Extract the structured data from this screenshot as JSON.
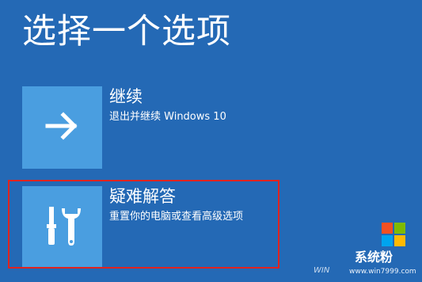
{
  "page": {
    "title": "选择一个选项"
  },
  "options": [
    {
      "title": "继续",
      "description": "退出并继续 Windows 10",
      "icon": "arrow-right-icon"
    },
    {
      "title": "疑难解答",
      "description": "重置你的电脑或查看高级选项",
      "icon": "tools-icon"
    }
  ],
  "watermark": {
    "brand": "系统粉",
    "url": "www.win7999.com",
    "url_prefix": "WIN",
    "logo_icon": "windows-logo-icon",
    "logo_colors": [
      "#f25022",
      "#7fba00",
      "#00a4ef",
      "#ffb900"
    ]
  },
  "colors": {
    "background": "#2469b5",
    "tile": "#4a9ee0",
    "highlight": "#e0231f"
  }
}
